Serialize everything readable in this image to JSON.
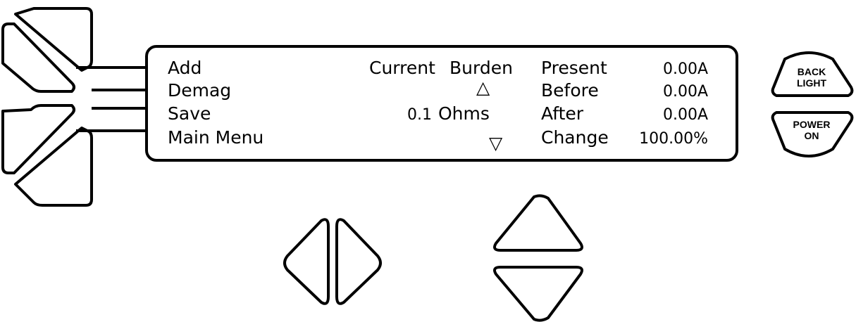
{
  "menu": {
    "items": [
      "Add",
      "Demag",
      "Save",
      "Main Menu"
    ]
  },
  "center": {
    "header_current": "Current",
    "header_burden": "Burden",
    "burden_value": "0.1",
    "burden_unit": "Ohms",
    "scroll_up_glyph": "△",
    "scroll_down_glyph": "▽"
  },
  "readings": {
    "labels": [
      "Present",
      "Before",
      "After",
      "Change"
    ],
    "values": [
      "0.00A",
      "0.00A",
      "0.00A",
      "100.00%"
    ]
  },
  "buttons": {
    "backlight_line1": "BACK",
    "backlight_line2": "LIGHT",
    "power_line1": "POWER",
    "power_line2": "ON"
  },
  "icons": {
    "softkey_upper": "softkey-upper-icon",
    "softkey_lower": "softkey-lower-icon",
    "left": "arrow-left-icon",
    "right": "arrow-right-icon",
    "up": "arrow-up-icon",
    "down": "arrow-down-icon"
  }
}
